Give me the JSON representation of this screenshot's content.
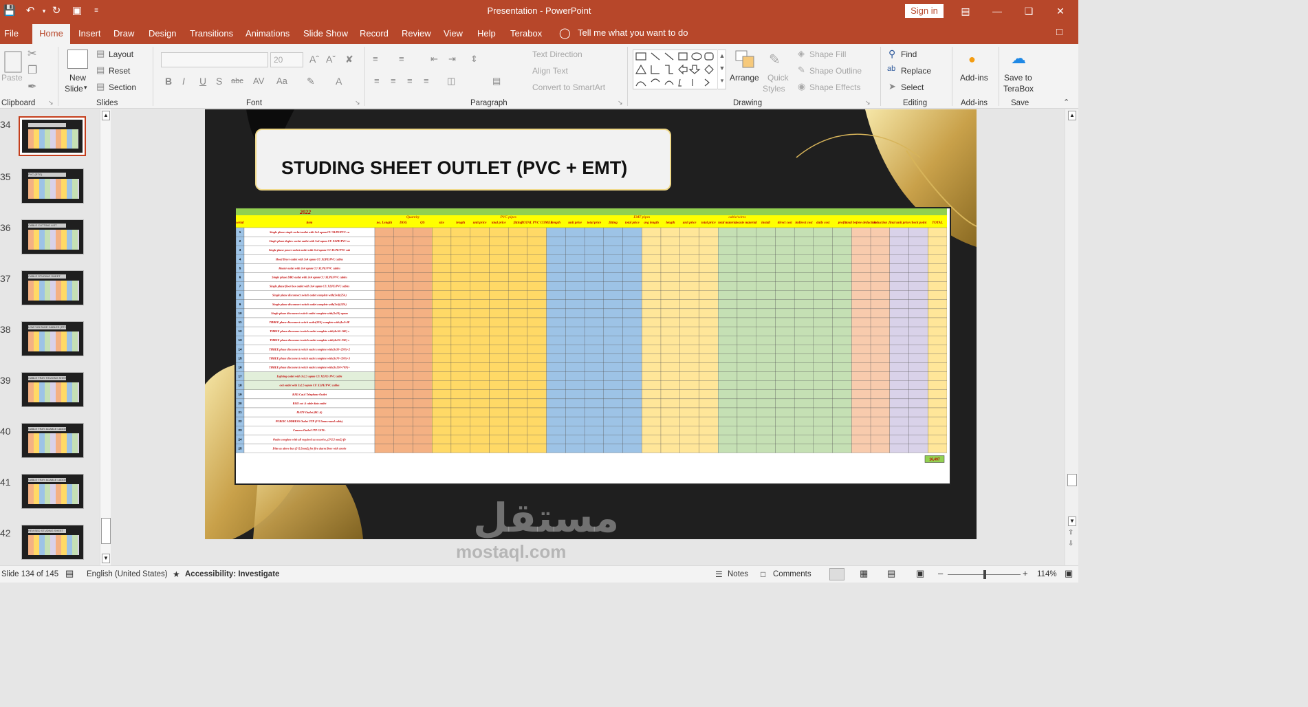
{
  "window": {
    "title": "Presentation  -  PowerPoint",
    "signin_label": "Sign in"
  },
  "menu": {
    "tabs": [
      "File",
      "Home",
      "Insert",
      "Draw",
      "Design",
      "Transitions",
      "Animations",
      "Slide Show",
      "Record",
      "Review",
      "View",
      "Help",
      "Terabox"
    ],
    "active": "Home",
    "tell_me": "Tell me what you want to do"
  },
  "ribbon": {
    "clipboard": {
      "paste": "Paste",
      "group": "Clipboard"
    },
    "slides": {
      "new_slide_1": "New",
      "new_slide_2": "Slide",
      "layout": "Layout",
      "reset": "Reset",
      "section": "Section",
      "group": "Slides"
    },
    "font": {
      "font_size": "20",
      "group": "Font"
    },
    "paragraph": {
      "text_direction": "Text Direction",
      "align_text": "Align Text",
      "smartart": "Convert to SmartArt",
      "group": "Paragraph"
    },
    "drawing": {
      "arrange": "Arrange",
      "quick_styles_1": "Quick",
      "quick_styles_2": "Styles",
      "shape_fill": "Shape Fill",
      "shape_outline": "Shape Outline",
      "shape_effects": "Shape Effects",
      "group": "Drawing"
    },
    "editing": {
      "find": "Find",
      "replace": "Replace",
      "select": "Select",
      "group": "Editing"
    },
    "addins": {
      "label": "Add-ins",
      "group": "Add-ins"
    },
    "save": {
      "label_1": "Save to",
      "label_2": "TeraBox",
      "group": "Save"
    }
  },
  "thumbnails": [
    {
      "num": "34",
      "title": "",
      "selected": true
    },
    {
      "num": "35",
      "title": "PVC (RTG)",
      "selected": false
    },
    {
      "num": "36",
      "title": "CABLE CUTTING LIST",
      "selected": false
    },
    {
      "num": "37",
      "title": "CABLE STUDING SHEET",
      "selected": false
    },
    {
      "num": "38",
      "title": "LOW VOLTAGE CABLES (RTG)",
      "selected": false
    },
    {
      "num": "39",
      "title": "CABLE TRAY STUDING SHEET",
      "selected": false
    },
    {
      "num": "40",
      "title": "CABLE TRAY &CABLE LADDER / TRAYING LR",
      "selected": false
    },
    {
      "num": "41",
      "title": "CABLE TRAY &CABLE LADDER&HOSE TRUNK LISTIG",
      "selected": false
    },
    {
      "num": "42",
      "title": "REVISED STUDING SHEET",
      "selected": false
    }
  ],
  "slide": {
    "title": "STUDING SHEET OUTLET (PVC + EMT)",
    "sheet": {
      "year": "2022",
      "groups": {
        "quantity": "Quantity",
        "pvc": "PVC pipes",
        "emt": "EMT pipes",
        "cables": "cable/wires"
      },
      "headers": [
        "serial",
        "item",
        "no. Length",
        "DOG",
        "QS",
        "size",
        "length",
        "unit price",
        "total price",
        "fitting",
        "TOTAL PVC COMER",
        "length",
        "unit price",
        "total price",
        "fitting",
        "total price",
        "avg length",
        "length",
        "unit price",
        "total price",
        "total material",
        "waste material",
        "install",
        "direct cost",
        "indirect cost",
        "daily cost",
        "profit",
        "total before deduction",
        "deduction",
        "final unit price",
        "check point",
        "TOTAL"
      ],
      "rows": [
        "Single phase single socket outlet with 3x4 sqmm CU XLPE/PVC cables",
        "Single phase duplex socket outlet with 3x4 sqmm CU XLPE/PVC cables",
        "Single phase power socket outlet with 3x4 sqmm CU XLPE/PVC cables",
        "Hood Dryer outlet with 3x4 sqmm CU XLPE/PVC cables",
        "Heater outlet with 3x4 sqmm CU XLPE/PVC cables",
        "Single phase DBU outlet with 3x4 sqmm CU XLPE/PVC cables",
        "Single phase floor box outlet with 3x4 sqmm CU XLPE/PVC cables",
        "Single phase disconnect switch outlet complete with(3x4)(25A) sqmm CU XLPE/PVC cables",
        "Single phase disconnect switch outlet complete with(3x6)(32A) sqmm CU XLPE/PVC cables",
        "Single phase disconnect switch outlet complete with(3x10) sqmm CU XLPE/PVC cables",
        "THREE phase disconnect switch outlet(32A) complete with(4x4+4E) sqmm CU XLPE/PVC cables",
        "THREE phase disconnect switch outlet complete with(4x16+16E) sqmm CU XLPE/PVC cables",
        "THREE phase disconnect switch outlet complete with(4x25+25E) sqmm CU XLPE/PVC cables",
        "THREE phase disconnect switch outlet complete with(3x50+25N)+25E sqmm CU XLPE/PVC cables",
        "THREE phase disconnect switch outlet complete with(3x70+35N)+35E sqmm CU XLPE/PVC cables",
        "THREE phase disconnect switch outlet complete with(3x150+70N)+70E sqmm CU XLPE/PVC cables",
        "Lighting outlet with 3x2.5 sqmm CU XLPE/ PVC cable",
        "exit outlet with 3x2.5 sqmm CU XLPE/PVC cables",
        "RJ45 Cat.6 Telephone Outlet",
        "RJ45 cat .6 cable data outlet",
        "MATV Outlet (RG .6)",
        "PUBLIC ADDRESS Outlet UTP (2*2.5mm round cable).",
        "Camera Outlet UTP CAT6 .",
        "Outlet complete with all required accessories, (2*2.5 mm2) fire retardant NH-1 copper conductor as shown per drawings and specs",
        "Ditto as above but (2*2.5mm2) for fire alarm Bore with strobe light"
      ],
      "grand_total": "16,497"
    }
  },
  "status": {
    "slide_info": "Slide 134 of 145",
    "language": "English (United States)",
    "accessibility": "Accessibility: Investigate",
    "notes": "Notes",
    "comments": "Comments",
    "zoom": "114%"
  },
  "watermark": {
    "arabic": "مستقل",
    "latin": "mostaql.com"
  }
}
